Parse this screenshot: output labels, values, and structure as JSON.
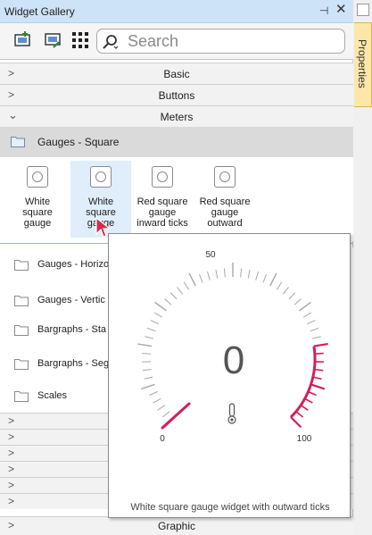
{
  "window": {
    "title": "Widget Gallery",
    "pin_glyph": "⊣",
    "close_glyph": "✕"
  },
  "toolbar": {
    "search_placeholder": "Search"
  },
  "categories": {
    "basic": "Basic",
    "buttons": "Buttons",
    "meters": "Meters",
    "graphic": "Graphic"
  },
  "subcategories": {
    "square": "Gauges - Square",
    "horizontal": "Gauges - Horizo",
    "vertical": "Gauges - Vertic",
    "bargraphs_st": "Bargraphs - Sta",
    "bargraphs_se": "Bargraphs - Seg",
    "scales": "Scales"
  },
  "widgets": [
    {
      "line1": "White",
      "line2": "square",
      "line3": "gauge"
    },
    {
      "line1": "White",
      "line2": "square",
      "line3": "gauge"
    },
    {
      "line1": "Red square",
      "line2": "gauge",
      "line3": "inward ticks"
    },
    {
      "line1": "Red square",
      "line2": "gauge",
      "line3": "outward"
    }
  ],
  "tooltip": {
    "value": "0",
    "min_label": "0",
    "mid_label": "50",
    "max_label": "100",
    "caption": "White square gauge widget with outward ticks",
    "accent_color": "#d21f5a"
  },
  "side_panel": {
    "label": "Properties"
  },
  "colors": {
    "titlebar": "#cde3f7",
    "selected": "#dfeefa",
    "tab": "#fde7a8"
  }
}
